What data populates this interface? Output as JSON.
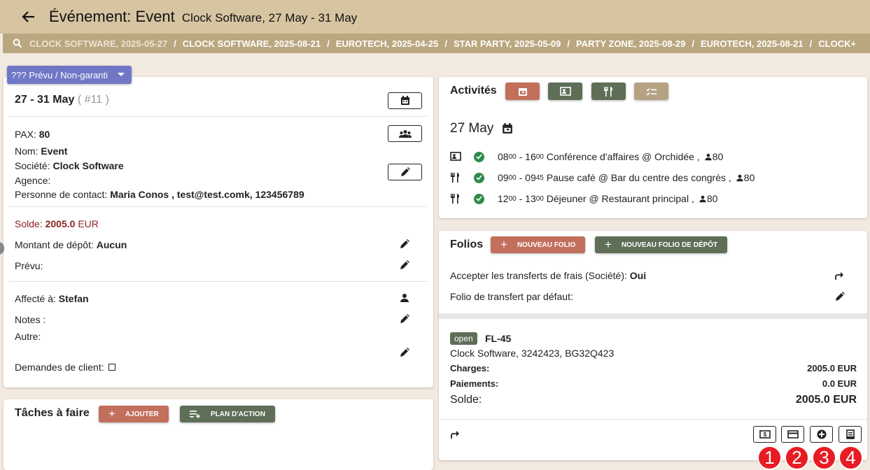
{
  "header": {
    "title": "Événement: Event",
    "subtitle": "Clock Software, 27 May - 31 May"
  },
  "breadcrumbs": [
    "CLOCK SOFTWARE, 2025-05-27",
    "CLOCK SOFTWARE, 2025-08-21",
    "EUROTECH, 2025-04-25",
    "STAR PARTY, 2025-05-09",
    "PARTY ZONE, 2025-08-29",
    "EUROTECH, 2025-08-21",
    "CLOCK+"
  ],
  "breadcrumb_separator": "/",
  "status_dropdown": {
    "value": "??? Prévu / Non-garanti"
  },
  "event_card": {
    "dates": "27 - 31 May",
    "number": "( #11 )",
    "pax_label": "PAX:",
    "pax_value": "80",
    "name_label": "Nom:",
    "name_value": "Event",
    "company_label": "Société:",
    "company_value": "Clock Software",
    "agency_label": "Agence:",
    "agency_value": "",
    "contact_label": "Personne de contact:",
    "contact_value": "Maria Conos , test@test.comk, 123456789",
    "balance_label": "Solde:",
    "balance_value": "2005.0",
    "balance_currency": "EUR",
    "deposit_label": "Montant de dépôt:",
    "deposit_value": "Aucun",
    "planned_label": "Prévu:",
    "assigned_label": "Affecté à:",
    "assigned_value": "Stefan",
    "notes_label": "Notes :",
    "other_label": "Autre:",
    "client_requests_label": "Demandes de client:"
  },
  "tasks": {
    "title": "Tâches à faire",
    "add_label": "AJOUTER",
    "plan_label": "PLAN D'ACTION"
  },
  "activities": {
    "title": "Activités",
    "day": "27 May",
    "items": [
      {
        "start_h": "08",
        "start_m": "00",
        "end_h": "16",
        "end_m": "00",
        "text": "Conférence d'affaires @ Orchidée ,",
        "pax": "80",
        "icon": "presentation-icon"
      },
      {
        "start_h": "09",
        "start_m": "00",
        "end_h": "09",
        "end_m": "45",
        "text": "Pause café @ Bar du centre des congrès ,",
        "pax": "80",
        "icon": "restaurant-icon"
      },
      {
        "start_h": "12",
        "start_m": "00",
        "end_h": "13",
        "end_m": "00",
        "text": "Déjeuner @ Restaurant principal ,",
        "pax": "80",
        "icon": "restaurant-icon"
      }
    ]
  },
  "folios": {
    "title": "Folios",
    "new_folio_label": "NOUVEAU FOLIO",
    "new_deposit_folio_label": "NOUVEAU FOLIO DE DÉPÔT",
    "accept_transfer_label": "Accepter les transferts de frais (Société):",
    "accept_transfer_value": "Oui",
    "default_transfer_label": "Folio de transfert par défaut:",
    "folio": {
      "status": "open",
      "id": "FL-45",
      "details": "Clock Software, 3242423, BG32Q423",
      "charges_label": "Charges:",
      "charges_value": "2005.0 EUR",
      "payments_label": "Paiements:",
      "payments_value": "0.0 EUR",
      "balance_label": "Solde:",
      "balance_value": "2005.0 EUR"
    }
  },
  "annotations": [
    "1",
    "2",
    "3",
    "4"
  ],
  "colors": {
    "header_bg": "#d7c4a1",
    "breadcrumb_bg": "#bba77f",
    "status_dd": "#6f77c6",
    "terracotta": "#c26f5c",
    "olive": "#5f6e57",
    "tan": "#b5a283",
    "balance_red": "#8b1f1f",
    "check_green": "#2e8b4a",
    "annotation_red": "#e81c24"
  }
}
